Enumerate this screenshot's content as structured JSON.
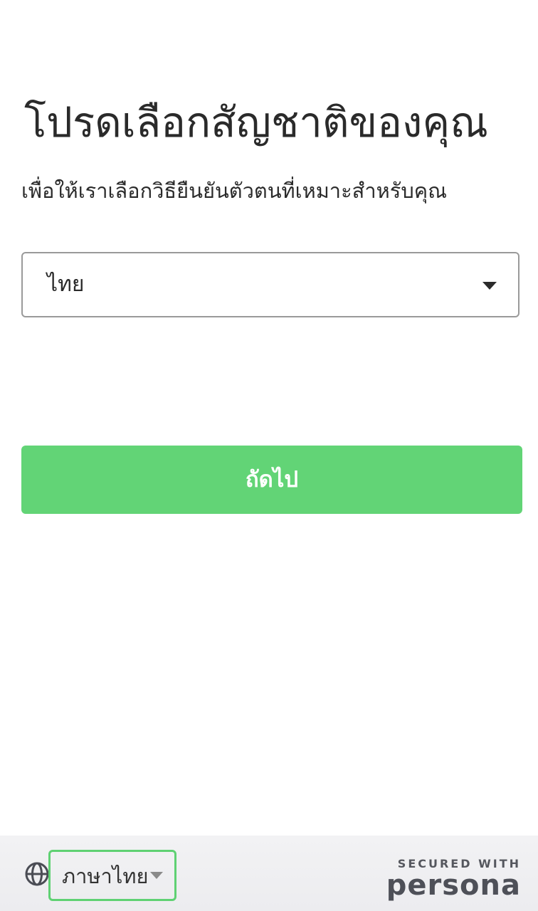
{
  "header": {
    "title": "โปรดเลือกสัญชาติของคุณ",
    "subtitle": "เพื่อให้เราเลือกวิธียืนยันตัวตนที่เหมาะสำหรับคุณ"
  },
  "nationality_select": {
    "selected": "ไทย",
    "icon": "caret-down-icon"
  },
  "actions": {
    "next_label": "ถัดไป",
    "next_color": "#62d476"
  },
  "footer": {
    "language_icon": "globe-icon",
    "language_label": "ภาษาไทย",
    "secured_label": "SECURED WITH",
    "brand": "persona"
  }
}
